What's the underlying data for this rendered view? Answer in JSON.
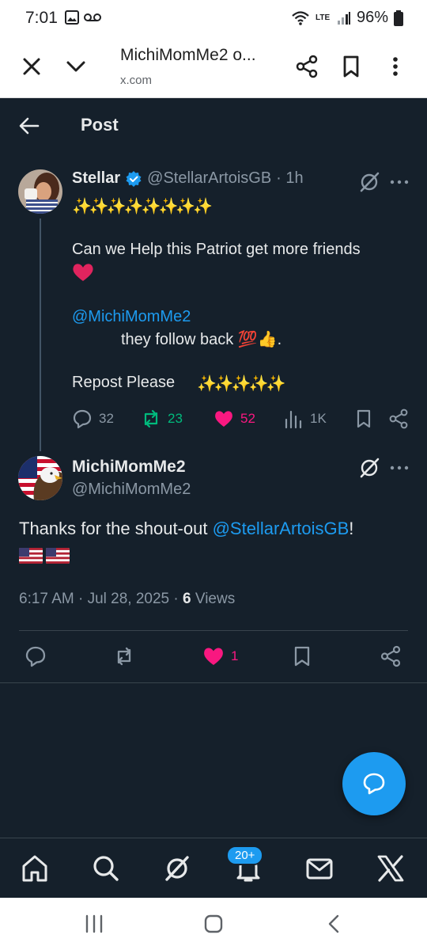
{
  "status_bar": {
    "time": "7:01",
    "battery": "96%",
    "network": "LTE"
  },
  "browser": {
    "title": "MichiMomMe2 o...",
    "url": "x.com"
  },
  "header": {
    "title": "Post"
  },
  "parent_post": {
    "display_name": "Stellar",
    "handle": "@StellarArtoisGB",
    "time": "· 1h",
    "sparkles_top": "✨✨✨✨✨✨✨✨",
    "line1": "Can we Help this Patriot get more friends",
    "heart_emoji": "❤️",
    "mention": "@MichiMomMe2",
    "line2": "they follow back 💯👍.",
    "line3": "Repost  Please",
    "sparkles_bottom": "✨✨✨✨✨",
    "replies": "32",
    "reposts": "23",
    "likes": "52",
    "views": "1K"
  },
  "reply_post": {
    "display_name": "MichiMomMe2",
    "handle": "@MichiMomMe2",
    "text_before": "Thanks for the shout-out ",
    "mention": "@StellarArtoisGB",
    "text_after": "!",
    "timestamp": "6:17 AM · Jul 28, 2025 · ",
    "views_count": "6",
    "views_label": " Views",
    "likes": "1"
  },
  "tabbar": {
    "notifications_badge": "20+"
  },
  "colors": {
    "background": "#15202b",
    "accent": "#1d9bf0",
    "like": "#f91880",
    "repost": "#00ba7c",
    "muted": "#8b98a5"
  }
}
